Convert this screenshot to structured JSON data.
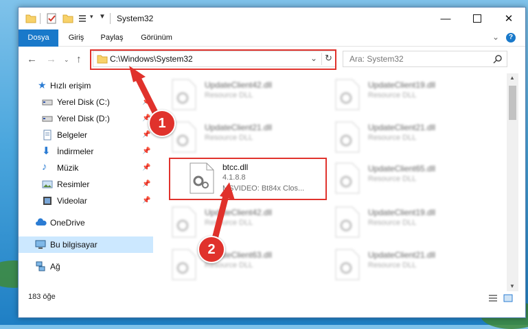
{
  "window": {
    "title": "System32"
  },
  "ribbon": {
    "tabs": [
      "Dosya",
      "Giriş",
      "Paylaş",
      "Görünüm"
    ]
  },
  "address": {
    "path": "C:\\Windows\\System32"
  },
  "search": {
    "placeholder": "Ara: System32"
  },
  "sidebar": {
    "items": [
      {
        "label": "Hızlı erişim",
        "icon": "star-icon"
      },
      {
        "label": "Yerel Disk (C:)",
        "icon": "drive-icon"
      },
      {
        "label": "Yerel Disk (D:)",
        "icon": "drive-icon"
      },
      {
        "label": "Belgeler",
        "icon": "documents-icon"
      },
      {
        "label": "İndirmeler",
        "icon": "download-icon"
      },
      {
        "label": "Müzik",
        "icon": "music-icon"
      },
      {
        "label": "Resimler",
        "icon": "pictures-icon"
      },
      {
        "label": "Videolar",
        "icon": "video-icon"
      },
      {
        "label": "OneDrive",
        "icon": "cloud-icon"
      },
      {
        "label": "Bu bilgisayar",
        "icon": "computer-icon"
      },
      {
        "label": "Ağ",
        "icon": "network-icon"
      }
    ]
  },
  "files": [
    {
      "name": "UpdateClient42.dll",
      "desc": "Resource DLL"
    },
    {
      "name": "UpdateClient19.dll",
      "desc": "Resource DLL"
    },
    {
      "name": "UpdateClient21.dll",
      "desc": "Resource DLL"
    },
    {
      "name": "UpdateClient21.dll",
      "desc": "Resource DLL"
    },
    {
      "name": "btcc.dll",
      "version": "4.1.8.8",
      "desc": "MSVIDEO: Bt84x Clos..."
    },
    {
      "name": "UpdateClient65.dll",
      "desc": "Resource DLL"
    },
    {
      "name": "UpdateClient42.dll",
      "desc": "Resource DLL"
    },
    {
      "name": "UpdateClient19.dll",
      "desc": "Resource DLL"
    },
    {
      "name": "UpdateClient63.dll",
      "desc": "Resource DLL"
    },
    {
      "name": "UpdateClient21.dll",
      "desc": "Resource DLL"
    }
  ],
  "status": {
    "count": "183 öğe"
  },
  "annotations": {
    "marker1": "1",
    "marker2": "2"
  },
  "colors": {
    "accent": "#1979ca",
    "annotation": "#e0322c",
    "selected": "#cce8ff"
  }
}
